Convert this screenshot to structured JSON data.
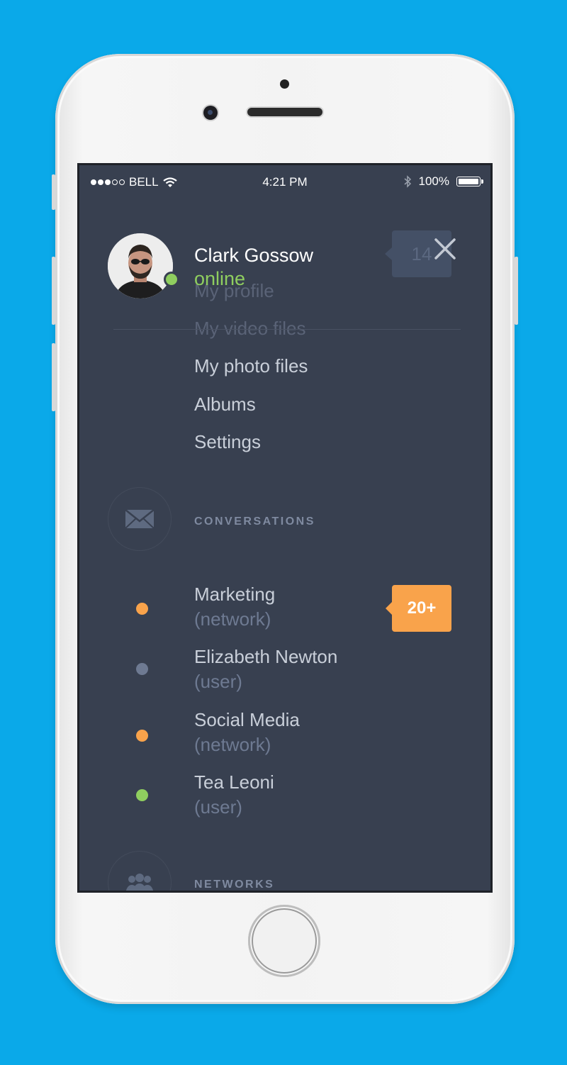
{
  "statusbar": {
    "carrier": "BELL",
    "time": "4:21 PM",
    "battery": "100%"
  },
  "profile": {
    "name": "Clark Gossow",
    "status": "online"
  },
  "ghost_menu": {
    "item1": "My profile",
    "item2": "My video files",
    "badge": "14"
  },
  "menu": {
    "items": [
      "My photo files",
      "Albums",
      "Settings"
    ]
  },
  "sections": {
    "conversations": "CONVERSATIONS",
    "networks": "NETWORKS"
  },
  "conversations": [
    {
      "title": "Marketing",
      "type": "(network)",
      "color": "#f9a34b"
    },
    {
      "title": "Elizabeth Newton",
      "type": "(user)",
      "color": "#6e7a92"
    },
    {
      "title": "Social Media",
      "type": "(network)",
      "color": "#f9a34b"
    },
    {
      "title": "Tea Leoni",
      "type": "(user)",
      "color": "#8fce5f"
    }
  ],
  "badge": {
    "label": "20+"
  },
  "icons": [
    "wifi-icon",
    "bluetooth-icon",
    "battery-icon",
    "close-icon",
    "envelope-icon",
    "group-icon"
  ],
  "colors": {
    "background": "#0aa9e9",
    "screen": "#384050",
    "online": "#8fce5f",
    "badge": "#f9a34b"
  }
}
